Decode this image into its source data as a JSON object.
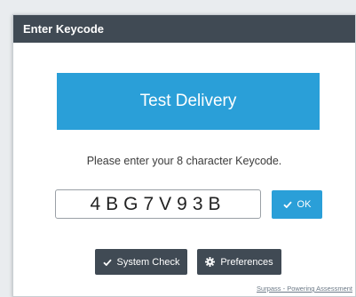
{
  "dialog": {
    "title": "Enter Keycode"
  },
  "banner": {
    "text": "Test Delivery"
  },
  "prompt": {
    "text": "Please enter your 8 character Keycode."
  },
  "keycode": {
    "value": "4BG7V93B"
  },
  "ok_button": {
    "label": "OK",
    "icon": "check-icon"
  },
  "system_check_button": {
    "label": "System Check",
    "icon": "check-icon"
  },
  "preferences_button": {
    "label": "Preferences",
    "icon": "gear-icon"
  },
  "footer": {
    "link_text": "Surpass - Powering Assessment"
  },
  "colors": {
    "title_bar": "#404a54",
    "accent": "#2a9fd8",
    "dark_button": "#404a54"
  }
}
